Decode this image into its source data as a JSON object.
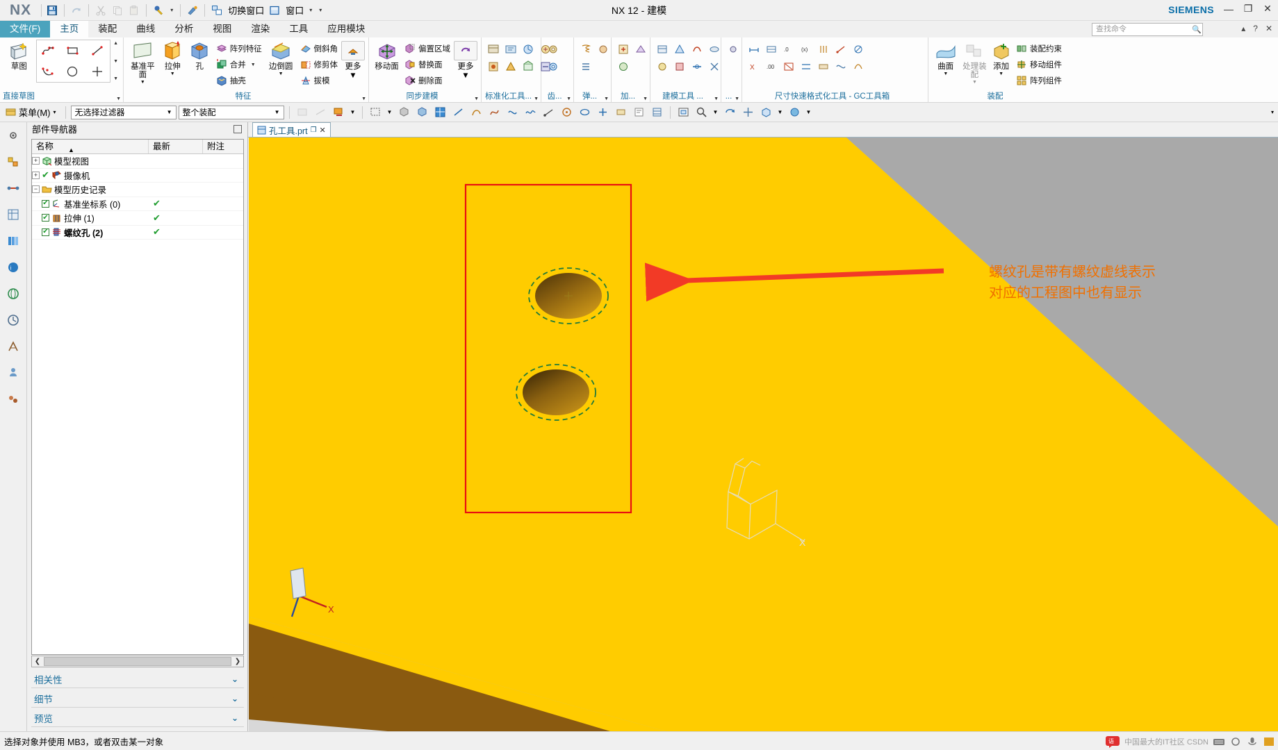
{
  "window": {
    "app_logo": "NX",
    "title": "NX 12 - 建模",
    "brand": "SIEMENS",
    "minimize": "—",
    "maximize": "❐",
    "close": "✕"
  },
  "quick_access": {
    "save": "save-icon",
    "redo": "redo-icon",
    "cut": "cut-icon",
    "copy": "copy-icon",
    "paste": "paste-icon",
    "undo_style": "style-icon",
    "paint": "paint-icon",
    "switch_window_label": "切换窗口",
    "window_label": "窗口",
    "caret": "▾",
    "overflow": "▾"
  },
  "tabs": [
    {
      "label": "文件(F)",
      "state": "file"
    },
    {
      "label": "主页",
      "state": "active"
    },
    {
      "label": "装配",
      "state": "normal"
    },
    {
      "label": "曲线",
      "state": "normal"
    },
    {
      "label": "分析",
      "state": "normal"
    },
    {
      "label": "视图",
      "state": "normal"
    },
    {
      "label": "渲染",
      "state": "normal"
    },
    {
      "label": "工具",
      "state": "normal"
    },
    {
      "label": "应用模块",
      "state": "normal"
    }
  ],
  "search": {
    "placeholder": "查找命令",
    "icon": "search-icon"
  },
  "ribbon": {
    "groups": [
      {
        "caption": "直接草图",
        "buttons": [
          {
            "label": "草图",
            "icon": "sketch-icon"
          },
          {
            "label": "轮廓",
            "icon": "profile-icon"
          },
          {
            "label": "矩形",
            "icon": "rectangle-icon"
          },
          {
            "label": "直线",
            "icon": "line-icon"
          },
          {
            "label": "圆弧",
            "icon": "arc-icon"
          },
          {
            "label": "圆",
            "icon": "circle-icon"
          },
          {
            "label": "快速修剪",
            "icon": "trim-icon"
          }
        ]
      },
      {
        "caption": "特征",
        "buttons": [
          {
            "label": "基准平面",
            "icon": "datum-plane-icon"
          },
          {
            "label": "拉伸",
            "icon": "extrude-icon"
          },
          {
            "label": "孔",
            "icon": "hole-icon"
          },
          {
            "label": "阵列特征",
            "icon": "pattern-feature-icon"
          },
          {
            "label": "合并",
            "icon": "unite-icon"
          },
          {
            "label": "抽壳",
            "icon": "shell-icon"
          },
          {
            "label": "边倒圆",
            "icon": "edge-blend-icon"
          },
          {
            "label": "倒斜角",
            "icon": "chamfer-icon"
          },
          {
            "label": "修剪体",
            "icon": "trim-body-icon"
          },
          {
            "label": "拔模",
            "icon": "draft-icon"
          },
          {
            "label": "更多",
            "icon": "more-icon"
          }
        ]
      },
      {
        "caption": "同步建模",
        "buttons": [
          {
            "label": "移动面",
            "icon": "move-face-icon"
          },
          {
            "label": "偏置区域",
            "icon": "offset-region-icon"
          },
          {
            "label": "替换面",
            "icon": "replace-face-icon"
          },
          {
            "label": "删除面",
            "icon": "delete-face-icon"
          },
          {
            "label": "更多",
            "icon": "more-icon"
          }
        ]
      },
      {
        "caption": "标准化工具...",
        "buttons": []
      },
      {
        "caption": "齿...",
        "buttons": []
      },
      {
        "caption": "弹...",
        "buttons": []
      },
      {
        "caption": "加...",
        "buttons": []
      },
      {
        "caption": "建模工具 ...",
        "buttons": []
      },
      {
        "caption": "...",
        "buttons": []
      },
      {
        "caption": "尺寸快速格式化工具 - GC工具箱",
        "buttons": []
      },
      {
        "caption": "装配",
        "buttons": [
          {
            "label": "曲面",
            "icon": "surface-icon"
          },
          {
            "label": "处理装配",
            "icon": "process-assembly-icon"
          },
          {
            "label": "添加",
            "icon": "add-component-icon"
          },
          {
            "label": "装配约束",
            "icon": "assembly-constraint-icon"
          },
          {
            "label": "移动组件",
            "icon": "move-component-icon"
          },
          {
            "label": "阵列组件",
            "icon": "pattern-component-icon"
          }
        ]
      }
    ]
  },
  "selection_bar": {
    "menu_label": "菜单(M)",
    "menu_caret": "▾",
    "filter_value": "无选择过滤器",
    "scope_value": "整个装配",
    "caret": "▾",
    "overflow": "▾"
  },
  "navigator": {
    "title": "部件导航器",
    "columns": [
      "名称",
      "最新",
      "附注"
    ],
    "sort_indicator": "▲",
    "rows": [
      {
        "indent": 0,
        "expander": "+",
        "checkbox": null,
        "icon": "model-view-icon",
        "label": "模型视图",
        "latest": "",
        "note": "",
        "bold": false
      },
      {
        "indent": 0,
        "expander": "+",
        "checkbox": "check",
        "icon": "camera-icon",
        "label": "摄像机",
        "latest": "",
        "note": "",
        "bold": false
      },
      {
        "indent": 0,
        "expander": "−",
        "checkbox": null,
        "icon": "folder-icon",
        "label": "模型历史记录",
        "latest": "",
        "note": "",
        "bold": false
      },
      {
        "indent": 1,
        "expander": null,
        "checkbox": "check",
        "icon": "datum-csys-icon",
        "label": "基准坐标系 (0)",
        "latest": "✔",
        "note": "",
        "bold": false
      },
      {
        "indent": 1,
        "expander": null,
        "checkbox": "check",
        "icon": "extrude-feature-icon",
        "label": "拉伸 (1)",
        "latest": "✔",
        "note": "",
        "bold": false
      },
      {
        "indent": 1,
        "expander": null,
        "checkbox": "check",
        "icon": "thread-hole-icon",
        "label": "螺纹孔 (2)",
        "latest": "✔",
        "note": "",
        "bold": true
      }
    ],
    "scroll_left": "❮",
    "scroll_right": "❯",
    "sections": [
      {
        "label": "相关性",
        "chevron": "⌄"
      },
      {
        "label": "细节",
        "chevron": "⌄"
      },
      {
        "label": "预览",
        "chevron": "⌄"
      }
    ]
  },
  "resource_bar": {
    "icons": [
      "settings-icon",
      "assembly-nav-icon",
      "constraint-nav-icon",
      "part-nav-icon",
      "reuse-library-icon",
      "hd3d-icon",
      "web-browser-icon",
      "history-icon",
      "process-studio-icon",
      "role-icon",
      "system-icon"
    ]
  },
  "document_tab": {
    "label": "孔工具.prt",
    "modified_icon": "modified-icon",
    "close": "✕",
    "icon": "part-file-icon"
  },
  "viewport": {
    "annotation_line1": "螺纹孔是带有螺纹虚线表示",
    "annotation_line2": "对应的工程图中也有显示",
    "annotation_color": "#f07000",
    "arrow_color": "#f23a26",
    "highlight_box_color": "#e81010",
    "body_color": "#ffcc00",
    "body_side_color": "#8a5a10",
    "background_color": "#b9b9b9",
    "hole_thread_dash_color": "#1f7a3a",
    "csys_label_x": "X",
    "triad_label_x": "X"
  },
  "status_bar": {
    "message": "选择对象并使用 MB3，或者双击某一对象",
    "watermark": "中国最大的IT社区 CSDN"
  }
}
